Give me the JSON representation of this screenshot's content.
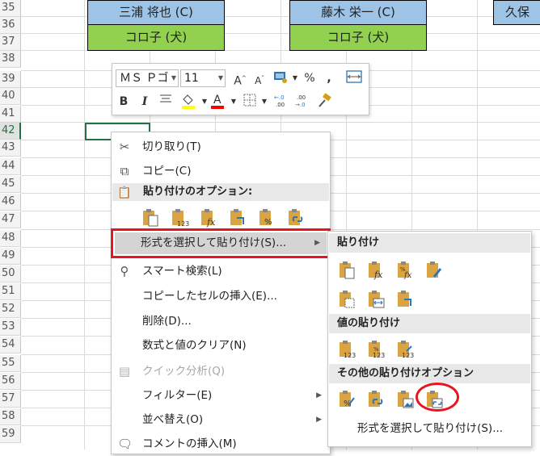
{
  "sheet": {
    "rows": [
      "35",
      "36",
      "37",
      "38",
      "39",
      "40",
      "41",
      "42",
      "43",
      "44",
      "45",
      "46",
      "47",
      "48",
      "49",
      "50",
      "51",
      "52",
      "53",
      "54",
      "55",
      "56",
      "57",
      "58",
      "59"
    ],
    "cards": [
      {
        "name": "三浦 将也 (C)",
        "pet": "コロ子 (犬)"
      },
      {
        "name": "藤木 栄一 (C)",
        "pet": "コロ子 (犬)"
      },
      {
        "name": "久保"
      }
    ]
  },
  "minibar": {
    "font_name": "ＭＳ Ｐゴ",
    "font_size": "11",
    "icons": [
      "grow-font-icon",
      "shrink-font-icon",
      "number-format-icon",
      "percent-icon",
      "comma-icon",
      "merge-center-icon",
      "bold-icon",
      "italic-icon",
      "align-center-icon",
      "fill-color-icon",
      "font-color-icon",
      "borders-icon",
      "increase-decimal-icon",
      "decrease-decimal-icon",
      "format-painter-icon"
    ],
    "bold": "B",
    "italic": "I",
    "percent": "%",
    "comma": ",",
    "fill_color": "#ffff00",
    "font_color": "#ff0000"
  },
  "context_menu": {
    "cut": "切り取り(T)",
    "copy": "コピー(C)",
    "paste_options_header": "貼り付けのオプション:",
    "paste_special": "形式を選択して貼り付け(S)...",
    "smart_lookup": "スマート検索(L)",
    "insert_copied": "コピーしたセルの挿入(E)...",
    "delete": "削除(D)...",
    "clear_contents": "数式と値のクリア(N)",
    "quick_analysis": "クイック分析(Q)",
    "filter": "フィルター(E)",
    "sort": "並べ替え(O)",
    "insert_comment": "コメントの挿入(M)"
  },
  "submenu": {
    "paste_header": "貼り付け",
    "values_header": "値の貼り付け",
    "other_header": "その他の貼り付けオプション",
    "paste_special_link": "形式を選択して貼り付け(S)..."
  },
  "highlight_color": "#e8141e"
}
